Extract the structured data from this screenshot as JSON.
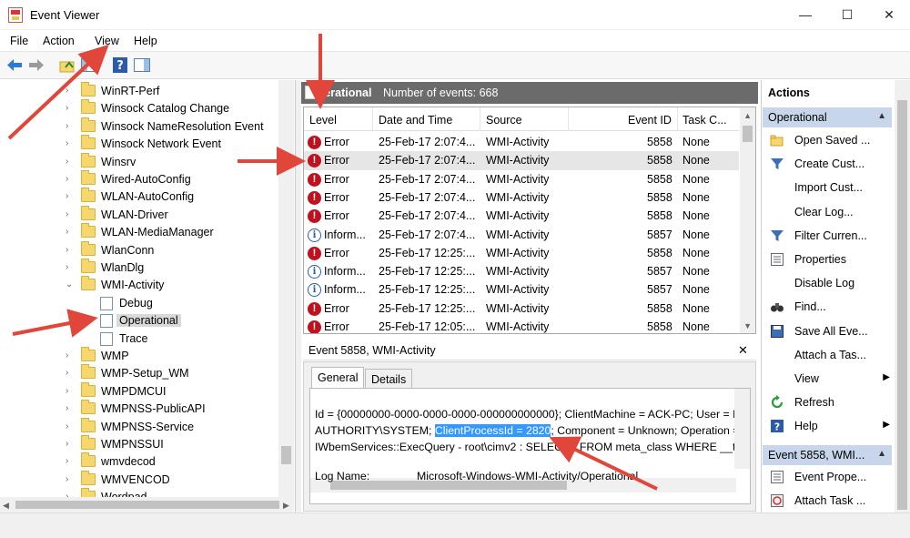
{
  "window": {
    "title": "Event Viewer",
    "minimize": "—",
    "maximize": "☐",
    "close": "✕"
  },
  "menu": [
    "File",
    "Action",
    "View",
    "Help"
  ],
  "tree": {
    "items": [
      {
        "label": "WinRT-Perf",
        "type": "folder"
      },
      {
        "label": "Winsock Catalog Change",
        "type": "folder"
      },
      {
        "label": "Winsock NameResolution Event",
        "type": "folder"
      },
      {
        "label": "Winsock Network Event",
        "type": "folder"
      },
      {
        "label": "Winsrv",
        "type": "folder"
      },
      {
        "label": "Wired-AutoConfig",
        "type": "folder"
      },
      {
        "label": "WLAN-AutoConfig",
        "type": "folder"
      },
      {
        "label": "WLAN-Driver",
        "type": "folder"
      },
      {
        "label": "WLAN-MediaManager",
        "type": "folder"
      },
      {
        "label": "WlanConn",
        "type": "folder"
      },
      {
        "label": "WlanDlg",
        "type": "folder"
      },
      {
        "label": "WMI-Activity",
        "type": "folder-open"
      },
      {
        "label": "Debug",
        "type": "log"
      },
      {
        "label": "Operational",
        "type": "log-selected"
      },
      {
        "label": "Trace",
        "type": "log"
      },
      {
        "label": "WMP",
        "type": "folder"
      },
      {
        "label": "WMP-Setup_WM",
        "type": "folder"
      },
      {
        "label": "WMPDMCUI",
        "type": "folder"
      },
      {
        "label": "WMPNSS-PublicAPI",
        "type": "folder"
      },
      {
        "label": "WMPNSS-Service",
        "type": "folder"
      },
      {
        "label": "WMPNSSUI",
        "type": "folder"
      },
      {
        "label": "wmvdecod",
        "type": "folder"
      },
      {
        "label": "WMVENCOD",
        "type": "folder"
      },
      {
        "label": "Wordpad",
        "type": "folder"
      }
    ]
  },
  "log_header": {
    "name": "Operational",
    "count_label": "Number of events: 668"
  },
  "columns": [
    "Level",
    "Date and Time",
    "Source",
    "Event ID",
    "Task C..."
  ],
  "events": [
    {
      "level": "Error",
      "date": "25-Feb-17 2:07:4...",
      "source": "WMI-Activity",
      "id": "5858",
      "task": "None"
    },
    {
      "level": "Error",
      "date": "25-Feb-17 2:07:4...",
      "source": "WMI-Activity",
      "id": "5858",
      "task": "None"
    },
    {
      "level": "Error",
      "date": "25-Feb-17 2:07:4...",
      "source": "WMI-Activity",
      "id": "5858",
      "task": "None"
    },
    {
      "level": "Error",
      "date": "25-Feb-17 2:07:4...",
      "source": "WMI-Activity",
      "id": "5858",
      "task": "None"
    },
    {
      "level": "Error",
      "date": "25-Feb-17 2:07:4...",
      "source": "WMI-Activity",
      "id": "5858",
      "task": "None"
    },
    {
      "level": "Inform...",
      "date": "25-Feb-17 2:07:4...",
      "source": "WMI-Activity",
      "id": "5857",
      "task": "None"
    },
    {
      "level": "Error",
      "date": "25-Feb-17 12:25:...",
      "source": "WMI-Activity",
      "id": "5858",
      "task": "None"
    },
    {
      "level": "Inform...",
      "date": "25-Feb-17 12:25:...",
      "source": "WMI-Activity",
      "id": "5857",
      "task": "None"
    },
    {
      "level": "Inform...",
      "date": "25-Feb-17 12:25:...",
      "source": "WMI-Activity",
      "id": "5857",
      "task": "None"
    },
    {
      "level": "Error",
      "date": "25-Feb-17 12:25:...",
      "source": "WMI-Activity",
      "id": "5858",
      "task": "None"
    },
    {
      "level": "Error",
      "date": "25-Feb-17 12:05:...",
      "source": "WMI-Activity",
      "id": "5858",
      "task": "None"
    }
  ],
  "detail": {
    "title": "Event 5858, WMI-Activity",
    "close": "✕",
    "tabs": [
      "General",
      "Details"
    ],
    "line1": "Id = {00000000-0000-0000-0000-000000000000}; ClientMachine = ACK-PC; User = NT",
    "line2_pre": "AUTHORITY\\SYSTEM; ",
    "line2_hl": "ClientProcessId = 2820",
    "line2_post": "; Component = Unknown; Operation = Start",
    "line3": "IWbemServices::ExecQuery - root\\cimv2 : SELECT * FROM meta_class WHERE __this ISA",
    "log_name_label": "Log Name:",
    "log_name_value": "Microsoft-Windows-WMI-Activity/Operational"
  },
  "actions": {
    "title": "Actions",
    "section1": "Operational",
    "items1": [
      {
        "label": "Open Saved ...",
        "icon": "folder-open-icon"
      },
      {
        "label": "Create Cust...",
        "icon": "filter-icon"
      },
      {
        "label": "Import Cust...",
        "icon": "blank-icon"
      },
      {
        "label": "Clear Log...",
        "icon": "blank-icon"
      },
      {
        "label": "Filter Curren...",
        "icon": "filter-icon"
      },
      {
        "label": "Properties",
        "icon": "properties-icon"
      },
      {
        "label": "Disable Log",
        "icon": "blank-icon"
      },
      {
        "label": "Find...",
        "icon": "binoculars-icon"
      },
      {
        "label": "Save All Eve...",
        "icon": "save-icon"
      },
      {
        "label": "Attach a Tas...",
        "icon": "blank-icon"
      },
      {
        "label": "View",
        "icon": "blank-icon",
        "submenu": true
      },
      {
        "label": "Refresh",
        "icon": "refresh-icon"
      },
      {
        "label": "Help",
        "icon": "help-icon",
        "submenu": true
      }
    ],
    "section2": "Event 5858, WMI...",
    "items2": [
      {
        "label": "Event Prope...",
        "icon": "properties-icon"
      },
      {
        "label": "Attach Task ...",
        "icon": "task-icon"
      }
    ]
  },
  "colors": {
    "header_bg": "#6b6b6b",
    "action_header_bg": "#c7d6ea",
    "error_red": "#c0111f",
    "highlight_blue": "#3399ff",
    "annotation_arrow": "#e0463a"
  }
}
